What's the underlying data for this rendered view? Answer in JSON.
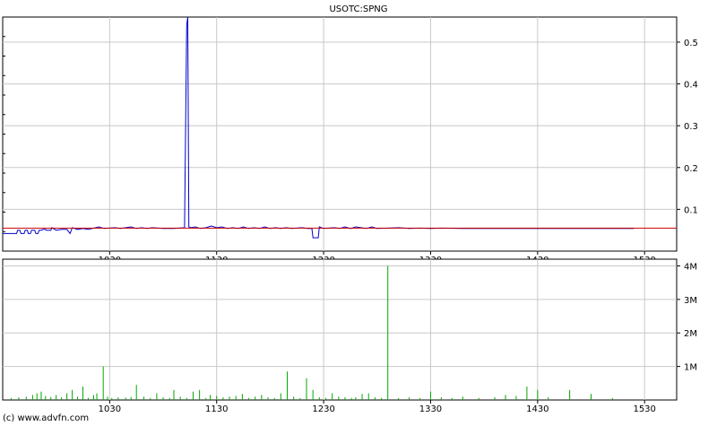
{
  "chart_data": [
    {
      "type": "line",
      "title": "USOTC:SPNG",
      "x_ticks": [
        "1030",
        "1130",
        "1230",
        "1330",
        "1430",
        "1530"
      ],
      "y_ticks": [
        "0.1",
        "0.2",
        "0.3",
        "0.4",
        "0.5"
      ],
      "xlim": [
        930,
        1560
      ],
      "ylim": [
        0.0,
        0.56
      ],
      "grid": true,
      "y_axis_side": "right",
      "series": [
        {
          "color": "#0000cc",
          "x": [
            930,
            943,
            944,
            946,
            947,
            950,
            951,
            953,
            954,
            956,
            957,
            960,
            961,
            963,
            964,
            966,
            968,
            970,
            971,
            975,
            976,
            980,
            985,
            990,
            993,
            995,
            1000,
            1005,
            1010,
            1020,
            1025,
            1035,
            1040,
            1050,
            1055,
            1060,
            1065,
            1070,
            1080,
            1090,
            1100,
            1102,
            1103,
            1104,
            1106,
            1110,
            1115,
            1120,
            1125,
            1130,
            1135,
            1140,
            1145,
            1150,
            1155,
            1160,
            1165,
            1170,
            1175,
            1180,
            1185,
            1190,
            1195,
            1200,
            1210,
            1215,
            1219,
            1220,
            1225,
            1226,
            1230,
            1240,
            1245,
            1250,
            1255,
            1260,
            1265,
            1270,
            1275,
            1280,
            1290,
            1300,
            1310,
            1320,
            1330,
            1340,
            1360,
            1380,
            1400,
            1420,
            1440,
            1460,
            1480,
            1500,
            1520
          ],
          "y": [
            0.042,
            0.042,
            0.05,
            0.05,
            0.042,
            0.042,
            0.05,
            0.05,
            0.042,
            0.042,
            0.05,
            0.05,
            0.042,
            0.042,
            0.05,
            0.05,
            0.052,
            0.052,
            0.05,
            0.05,
            0.056,
            0.05,
            0.052,
            0.052,
            0.042,
            0.056,
            0.052,
            0.054,
            0.052,
            0.058,
            0.054,
            0.056,
            0.054,
            0.058,
            0.054,
            0.056,
            0.054,
            0.056,
            0.054,
            0.054,
            0.056,
            0.54,
            0.56,
            0.058,
            0.056,
            0.058,
            0.054,
            0.056,
            0.06,
            0.056,
            0.058,
            0.054,
            0.056,
            0.054,
            0.058,
            0.054,
            0.056,
            0.054,
            0.058,
            0.054,
            0.056,
            0.054,
            0.056,
            0.054,
            0.056,
            0.054,
            0.054,
            0.032,
            0.032,
            0.058,
            0.054,
            0.056,
            0.054,
            0.058,
            0.054,
            0.058,
            0.056,
            0.054,
            0.058,
            0.054,
            0.055,
            0.056,
            0.054,
            0.055,
            0.054,
            0.055,
            0.054,
            0.054,
            0.054,
            0.054,
            0.054,
            0.054,
            0.054,
            0.054,
            0.054
          ]
        },
        {
          "color": "#cc0000",
          "x": [
            930,
            1560
          ],
          "y": [
            0.055,
            0.055
          ]
        }
      ]
    },
    {
      "type": "bar",
      "x_ticks": [
        "1030",
        "1130",
        "1230",
        "1330",
        "1430",
        "1530"
      ],
      "y_ticks": [
        "1M",
        "2M",
        "3M",
        "4M"
      ],
      "xlim": [
        930,
        1560
      ],
      "ylim": [
        0,
        4200000
      ],
      "grid": true,
      "y_axis_side": "right",
      "bar_color": "#00aa00",
      "x": [
        938,
        945,
        952,
        958,
        962,
        966,
        970,
        975,
        980,
        985,
        990,
        995,
        1000,
        1005,
        1010,
        1015,
        1018,
        1024,
        1028,
        1032,
        1038,
        1045,
        1050,
        1055,
        1062,
        1068,
        1074,
        1080,
        1086,
        1090,
        1096,
        1102,
        1108,
        1114,
        1120,
        1124,
        1130,
        1136,
        1142,
        1148,
        1154,
        1160,
        1166,
        1172,
        1178,
        1184,
        1190,
        1196,
        1202,
        1208,
        1214,
        1220,
        1226,
        1232,
        1238,
        1244,
        1250,
        1256,
        1260,
        1266,
        1272,
        1278,
        1284,
        1290,
        1300,
        1310,
        1320,
        1330,
        1340,
        1350,
        1360,
        1375,
        1390,
        1400,
        1410,
        1420,
        1430,
        1440,
        1460,
        1480,
        1500
      ],
      "values": [
        60000,
        80000,
        100000,
        150000,
        200000,
        250000,
        120000,
        90000,
        150000,
        80000,
        200000,
        300000,
        100000,
        400000,
        60000,
        150000,
        200000,
        1000000,
        100000,
        60000,
        80000,
        70000,
        90000,
        450000,
        100000,
        60000,
        200000,
        80000,
        60000,
        300000,
        100000,
        60000,
        250000,
        300000,
        60000,
        150000,
        120000,
        80000,
        100000,
        120000,
        180000,
        60000,
        100000,
        150000,
        80000,
        60000,
        200000,
        850000,
        100000,
        60000,
        650000,
        300000,
        80000,
        60000,
        200000,
        100000,
        80000,
        60000,
        80000,
        180000,
        200000,
        80000,
        60000,
        4000000,
        60000,
        80000,
        60000,
        250000,
        80000,
        60000,
        100000,
        60000,
        80000,
        150000,
        120000,
        400000,
        300000,
        80000,
        300000,
        180000,
        60000
      ]
    }
  ],
  "footer": {
    "credit": "(c) www.advfn.com"
  }
}
